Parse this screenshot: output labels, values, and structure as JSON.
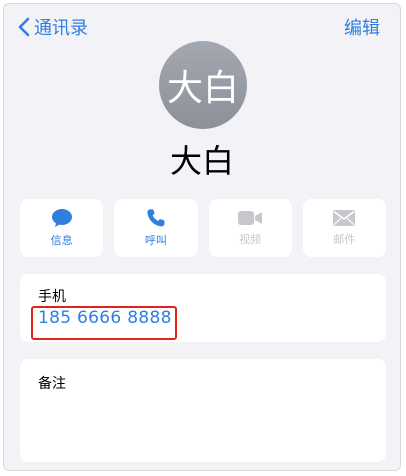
{
  "nav": {
    "back_label": "通讯录",
    "edit_label": "编辑"
  },
  "contact": {
    "avatar_text": "大白",
    "name": "大白"
  },
  "actions": [
    {
      "label": "信息",
      "icon": "message-bubble-icon",
      "enabled": true
    },
    {
      "label": "呼叫",
      "icon": "phone-icon",
      "enabled": true
    },
    {
      "label": "视频",
      "icon": "video-camera-icon",
      "enabled": false
    },
    {
      "label": "邮件",
      "icon": "mail-envelope-icon",
      "enabled": false
    }
  ],
  "phone": {
    "label": "手机",
    "number": "185 6666 8888"
  },
  "notes": {
    "label": "备注"
  },
  "colors": {
    "accent": "#2f7fe0",
    "disabled": "#c7c7cc",
    "highlight_border": "#e0241b",
    "background": "#f2f2f7"
  }
}
